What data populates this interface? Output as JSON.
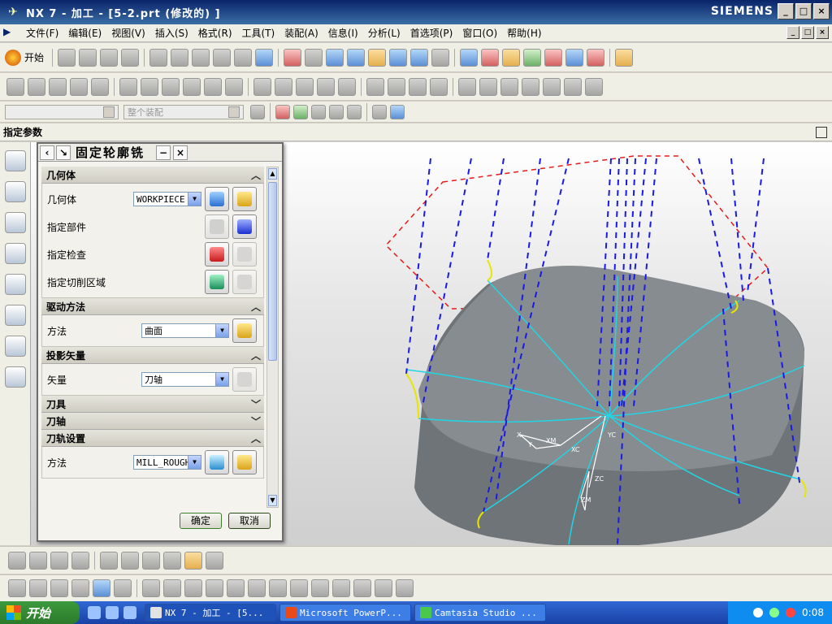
{
  "window": {
    "app_icon": "nx-logo-icon",
    "title": "NX 7 - 加工 - [5-2.prt (修改的) ]",
    "brand": "SIEMENS",
    "controls": [
      "_",
      "□",
      "×"
    ]
  },
  "menubar": {
    "items": [
      "文件(F)",
      "编辑(E)",
      "视图(V)",
      "插入(S)",
      "格式(R)",
      "工具(T)",
      "装配(A)",
      "信息(I)",
      "分析(L)",
      "首选项(P)",
      "窗口(O)",
      "帮助(H)"
    ]
  },
  "toolbar": {
    "start_label": "开始",
    "filter_placeholder": "",
    "assembly_filter": "整个装配"
  },
  "specify_bar": {
    "label": "指定参数"
  },
  "dialog": {
    "title": "固定轮廓铣",
    "sections": {
      "geometry": {
        "title": "几何体",
        "geometry_label": "几何体",
        "geometry_value": "WORKPIECE",
        "part_label": "指定部件",
        "check_label": "指定检查",
        "cut_area_label": "指定切削区域"
      },
      "drive": {
        "title": "驱动方法",
        "method_label": "方法",
        "method_value": "曲面"
      },
      "projection": {
        "title": "投影矢量",
        "vector_label": "矢量",
        "vector_value": "刀轴"
      },
      "tool": {
        "title": "刀具"
      },
      "axis": {
        "title": "刀轴"
      },
      "path_settings": {
        "title": "刀轨设置",
        "method_label": "方法",
        "method_value": "MILL_ROUGH"
      }
    },
    "ok_label": "确定",
    "cancel_label": "取消"
  },
  "viewport": {
    "axis_labels": [
      "YC",
      "XC",
      "ZC",
      "X",
      "Y",
      "XM",
      "ZM"
    ]
  },
  "taskbar": {
    "start_label": "开始",
    "tasks": [
      "NX 7 - 加工 - [5...",
      "Microsoft PowerP...",
      "Camtasia Studio ..."
    ],
    "clock": "0:08"
  },
  "colors": {
    "title_bar": "#0a246a",
    "toolpath_dash": "#1a1ae6",
    "toolpath_cyan": "#1fd6e6",
    "safety_plane": "#e61a1a",
    "part_gray": "#6f7478"
  }
}
